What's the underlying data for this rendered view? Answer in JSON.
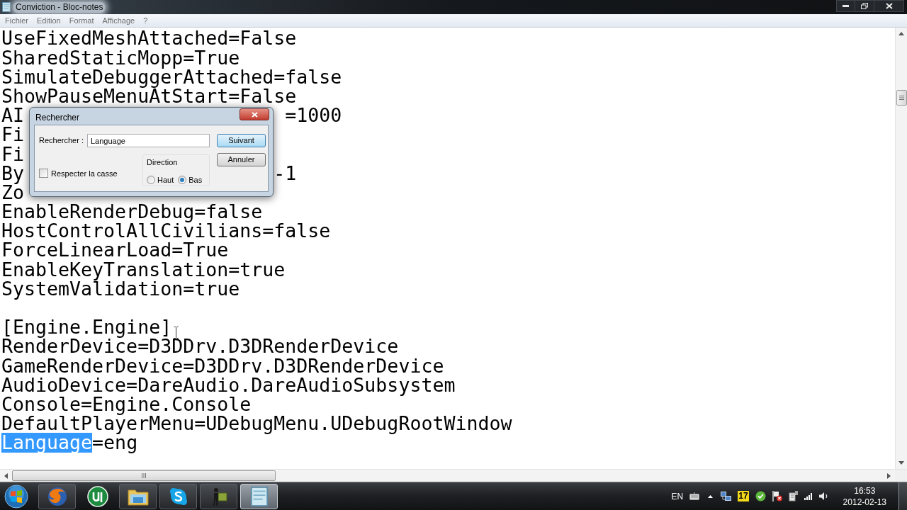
{
  "window": {
    "title": "Conviction - Bloc-notes"
  },
  "menu": [
    "Fichier",
    "Edition",
    "Format",
    "Affichage",
    "?"
  ],
  "editor": {
    "lines": [
      {
        "kind": "plain",
        "text": "UseFixedMeshAttached=False"
      },
      {
        "kind": "plain",
        "text": "SharedStaticMopp=True"
      },
      {
        "kind": "plain",
        "text": "SimulateDebuggerAttached=false"
      },
      {
        "kind": "plain",
        "text": "ShowPauseMenuAtStart=False"
      },
      {
        "kind": "covered",
        "head": "AI",
        "tail": "=1000"
      },
      {
        "kind": "covered",
        "head": "Fi"
      },
      {
        "kind": "covered",
        "head": "Fi"
      },
      {
        "kind": "covered",
        "head": "By",
        "tail": "-1"
      },
      {
        "kind": "covered",
        "head": "Zo"
      },
      {
        "kind": "plain",
        "text": "EnableRenderDebug=false"
      },
      {
        "kind": "plain",
        "text": "HostControlAllCivilians=false"
      },
      {
        "kind": "plain",
        "text": "ForceLinearLoad=True"
      },
      {
        "kind": "plain",
        "text": "EnableKeyTranslation=true"
      },
      {
        "kind": "plain",
        "text": "SystemValidation=true"
      },
      {
        "kind": "blank"
      },
      {
        "kind": "plain",
        "text": "[Engine.Engine]"
      },
      {
        "kind": "plain",
        "text": "RenderDevice=D3DDrv.D3DRenderDevice"
      },
      {
        "kind": "plain",
        "text": "GameRenderDevice=D3DDrv.D3DRenderDevice"
      },
      {
        "kind": "plain",
        "text": "AudioDevice=DareAudio.DareAudioSubsystem"
      },
      {
        "kind": "plain",
        "text": "Console=Engine.Console"
      },
      {
        "kind": "plain",
        "text": "DefaultPlayerMenu=UDebugMenu.UDebugRootWindow"
      },
      {
        "kind": "selection",
        "segments": [
          {
            "text": "Language",
            "selected": true
          },
          {
            "text": "=eng",
            "selected": false
          }
        ]
      }
    ]
  },
  "find_dialog": {
    "title": "Rechercher",
    "search_label": "Rechercher :",
    "search_value": "Language",
    "buttons": [
      {
        "label": "Suivant",
        "default": true
      },
      {
        "label": "Annuler",
        "default": false
      }
    ],
    "direction": {
      "label": "Direction",
      "options": [
        {
          "label": "Haut",
          "selected": false
        },
        {
          "label": "Bas",
          "selected": true
        }
      ]
    },
    "match_case": {
      "label": "Respecter la casse",
      "checked": false
    }
  },
  "taskbar": {
    "buttons": [
      {
        "running": true,
        "selected": false
      },
      {
        "running": false,
        "selected": false
      },
      {
        "running": true,
        "selected": false
      },
      {
        "running": true,
        "selected": false
      },
      {
        "running": true,
        "selected": false
      },
      {
        "running": true,
        "selected": true
      }
    ],
    "tray": {
      "language": "EN",
      "badge": "17",
      "time": "16:53",
      "date": "2012-02-13"
    }
  }
}
